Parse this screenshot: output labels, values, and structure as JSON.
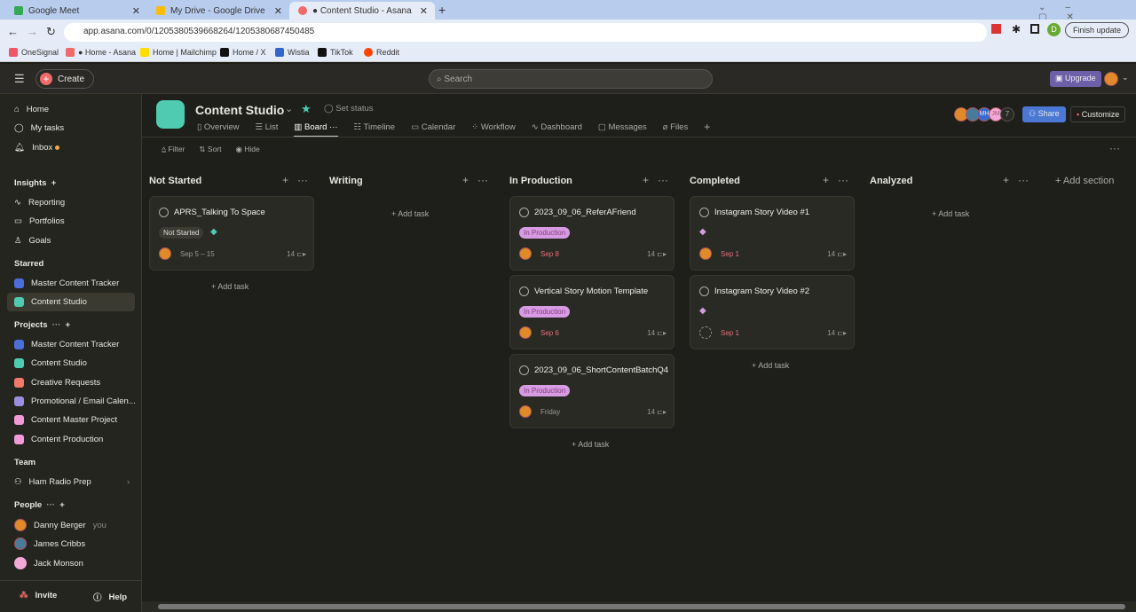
{
  "browser": {
    "tabs": [
      "Google Meet",
      "My Drive - Google Drive",
      "● Content Studio - Asana"
    ],
    "url": "app.asana.com/0/1205380539668264/1205380687450485",
    "finish_update": "Finish update",
    "profile": "D",
    "bookmarks": [
      "OneSignal",
      "● Home - Asana",
      "Home | Mailchimp",
      "Home / X",
      "Wistia",
      "TikTok",
      "Reddit"
    ]
  },
  "topbar": {
    "create": "Create",
    "search_placeholder": "Search",
    "upgrade": "Upgrade"
  },
  "sidebar": {
    "nav": [
      "Home",
      "My tasks",
      "Inbox"
    ],
    "insights": "Insights",
    "insight_items": [
      "Reporting",
      "Portfolios",
      "Goals"
    ],
    "starred": "Starred",
    "starred_items": [
      {
        "label": "Master Content Tracker",
        "color": "#4a6fd8"
      },
      {
        "label": "Content Studio",
        "color": "#4ecbb0"
      }
    ],
    "projects": "Projects",
    "project_items": [
      {
        "label": "Master Content Tracker",
        "color": "#4a6fd8"
      },
      {
        "label": "Content Studio",
        "color": "#4ecbb0"
      },
      {
        "label": "Creative Requests",
        "color": "#f07a6a"
      },
      {
        "label": "Promotional / Email Calen...",
        "color": "#9b8ee0"
      },
      {
        "label": "Content Master Project",
        "color": "#f29ad8"
      },
      {
        "label": "Content Production",
        "color": "#f29ad8"
      }
    ],
    "team": "Team",
    "team_item": "Ham Radio Prep",
    "people": "People",
    "people_items": [
      "Danny Berger",
      "James Cribbs",
      "Jack Monson"
    ],
    "you": "you",
    "invite": "Invite",
    "help": "Help"
  },
  "project": {
    "title": "Content Studio",
    "set_status": "Set status",
    "tabs": [
      "Overview",
      "List",
      "Board",
      "Timeline",
      "Calendar",
      "Workflow",
      "Dashboard",
      "Messages",
      "Files"
    ],
    "active_tab": "Board",
    "member_count": "7",
    "member_initials": [
      "MH",
      "JM"
    ],
    "share": "Share",
    "customize": "Customize",
    "filter": "Filter",
    "sort": "Sort",
    "hide": "Hide"
  },
  "board": {
    "add_task": "+ Add task",
    "add_section": "+ Add section",
    "columns": [
      {
        "name": "Not Started",
        "cards": [
          {
            "title": "APRS_Talking To Space",
            "tag": "Not Started",
            "date": "Sep 5 – 15",
            "count": "14"
          }
        ]
      },
      {
        "name": "Writing",
        "cards": []
      },
      {
        "name": "In Production",
        "cards": [
          {
            "title": "2023_09_06_ReferAFriend",
            "tag": "In Production",
            "date": "Sep 8",
            "count": "14"
          },
          {
            "title": "Vertical Story Motion Template",
            "tag": "In Production",
            "date": "Sep 6",
            "count": "14"
          },
          {
            "title": "2023_09_06_ShortContentBatchQ4",
            "tag": "In Production",
            "date": "Friday",
            "count": "14"
          }
        ]
      },
      {
        "name": "Completed",
        "cards": [
          {
            "title": "Instagram Story Video #1",
            "date": "Sep 1",
            "count": "14"
          },
          {
            "title": "Instagram Story Video #2",
            "date": "Sep 1",
            "count": "14"
          }
        ]
      },
      {
        "name": "Analyzed",
        "cards": []
      }
    ]
  }
}
